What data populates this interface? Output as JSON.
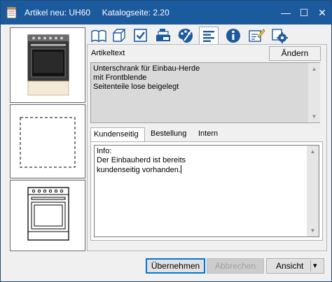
{
  "window": {
    "title": "Artikel neu: UH60     Katalogseite: 2.20",
    "buttons": {
      "minimize": "—",
      "maximize": "☐",
      "close": "✕"
    }
  },
  "toolbar": {
    "icons": [
      "book-icon",
      "cube-icon",
      "checkbox-icon",
      "register-icon",
      "palette-icon",
      "text-align-icon",
      "info-icon",
      "edit-note-icon",
      "settings-icon"
    ],
    "active_index": 5
  },
  "artikeltext": {
    "label": "Artikeltext",
    "change_button": "Ändern",
    "text": "Unterschrank für Einbau-Herde\nmit Frontblende\nSeitenteile lose beigelegt"
  },
  "notes": {
    "tabs": [
      "Kundenseitig",
      "Bestellung",
      "Intern"
    ],
    "active_tab": 0,
    "text": "Info:\nDer Einbauherd ist bereits\nkundenseitig vorhanden."
  },
  "footer": {
    "apply_button": "Übernehmen",
    "cancel_button": "Abbrechen",
    "view_button": "Ansicht",
    "view_dropdown_arrow": "▾"
  },
  "colors": {
    "titlebar": "#1c5a9e",
    "window_bg": "#f0f0f0",
    "default_button_border": "#0078d7",
    "icon_blue": "#1c5a9e"
  }
}
